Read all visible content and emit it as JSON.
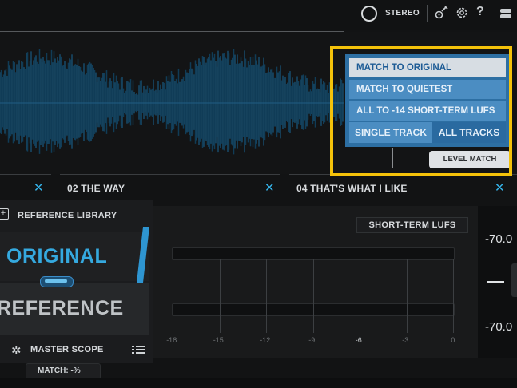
{
  "topbar": {
    "stereo_label": "STEREO",
    "help_label": "?"
  },
  "tracks": [
    {
      "name": "02 THE WAY",
      "close": "✕"
    },
    {
      "name": "04 THAT'S WHAT I LIKE",
      "close": "✕"
    },
    {
      "name": "",
      "close": "✕"
    }
  ],
  "level_match": {
    "options": [
      "MATCH TO ORIGINAL",
      "MATCH TO QUIETEST",
      "ALL TO -14 SHORT-TERM LUFS"
    ],
    "selected_option": "MATCH TO ORIGINAL",
    "single_track": "SINGLE TRACK",
    "all_tracks": "ALL TRACKS",
    "button": "LEVEL MATCH",
    "highlight_color": "#f4c20a"
  },
  "left_panel": {
    "reference_library": "REFERENCE LIBRARY",
    "original": "ORIGINAL",
    "reference": "REFERENCE",
    "master_scope": "MASTER SCOPE",
    "match": "MATCH: -%"
  },
  "meter": {
    "mode": "SHORT-TERM LUFS",
    "ticks": [
      "-18",
      "-15",
      "-12",
      "-9",
      "-6",
      "-3",
      "0"
    ],
    "highlight_tick": "-6"
  },
  "readout": {
    "top_value": "-70.0",
    "bottom_value": "-70.0"
  },
  "colors": {
    "accent_blue": "#35a9df",
    "panel_blue": "#2d6fa3"
  }
}
